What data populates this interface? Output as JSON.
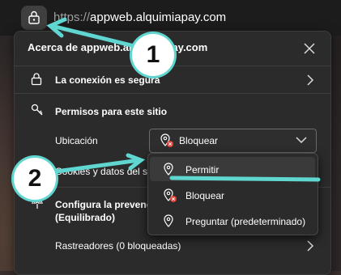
{
  "browser": {
    "url_protocol": "https://",
    "url_host": "appweb.alquimiapay.com",
    "lock_icon": "lock-icon"
  },
  "panel": {
    "title": "Acerca de appweb.alquimiapay.com",
    "connection_label": "La conexión es segura",
    "permissions_label": "Permisos para este sitio",
    "location_label": "Ubicación",
    "location_value": "Bloquear",
    "cookies_label": "Cookies y datos del sitio",
    "tracking_label_line1": "Configura la prevención de seguimiento",
    "tracking_label_line2": "(Equilibrado)",
    "trackers_label": "Rastreadores (0 bloqueadas)"
  },
  "dropdown": {
    "options": [
      {
        "label": "Permitir",
        "highlighted": true
      },
      {
        "label": "Bloquear",
        "highlighted": false
      },
      {
        "label": "Preguntar (predeterminado)",
        "highlighted": false
      }
    ]
  },
  "annotations": {
    "step1": "1",
    "step2": "2",
    "arrow_color": "#5fd6d0"
  },
  "colors": {
    "panel_bg": "#2b2b2b",
    "accent": "#5fd6d0",
    "block_red": "#e0433a"
  }
}
